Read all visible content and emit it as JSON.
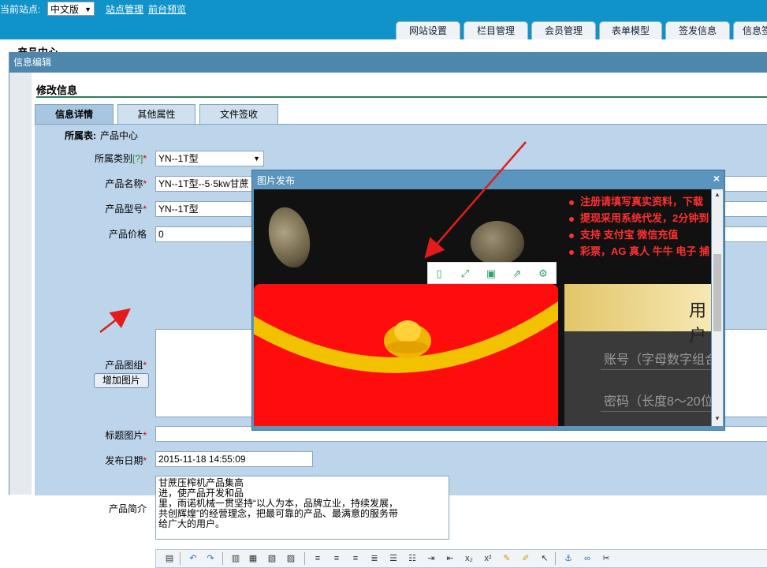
{
  "topbar": {
    "site_label": "当前站点:",
    "site_select": "中文版",
    "links": [
      "站点管理",
      "前台预览"
    ],
    "tabs": [
      "网站设置",
      "栏目管理",
      "会员管理",
      "表单模型",
      "签发信息",
      "信息签"
    ]
  },
  "page": {
    "behind_title": "产品中心"
  },
  "panel": {
    "title": "信息编辑",
    "section_title": "修改信息",
    "form_tabs": [
      "信息详情",
      "其他属性",
      "文件签收"
    ]
  },
  "form": {
    "table_label": "所属表:",
    "table_value": "产品中心",
    "category_label": "所属类别",
    "category_help": "[?]",
    "category_value": "YN--1T型",
    "name_label": "产品名称",
    "name_value": "YN--1T型--5·5kw甘蔗",
    "model_label": "产品型号",
    "model_value": "YN--1T型",
    "price_label": "产品价格",
    "price_value": "0",
    "images_label": "产品图组",
    "add_image_button": "增加图片",
    "title_image_label": "标题图片",
    "date_label": "发布日期",
    "date_value": "2015-11-18 14:55:09",
    "intro_label": "产品简介",
    "intro_lines": [
      "甘蔗压榨机产品集高",
      "进，使产品开发和品",
      "里，雨诺机械一贯坚持“以人为本，品牌立业，持续发展，",
      "共创辉煌”的经营理念，把最可靠的产品、最满意的服务带",
      "给广大的用户。"
    ],
    "required_mark": "*"
  },
  "modal": {
    "title": "图片发布",
    "close": "×",
    "bullets": [
      "注册请填写真实资料，下载",
      "提现采用系统代发，2分钟到",
      "支持 支付宝 微信充值",
      "彩票，AG 真人 牛牛 电子 捕"
    ],
    "login_heading": "用户",
    "account_placeholder": "账号（字母数字组合",
    "password_placeholder": "密码（长度8～20位"
  },
  "colors": {
    "topbar": "#0f93c9",
    "panel_title": "#4e86ad",
    "form_bg": "#bcd5ea",
    "envelope_red": "#ff0c0c",
    "envelope_band": "#f2c200",
    "promo_red": "#ff3030"
  }
}
